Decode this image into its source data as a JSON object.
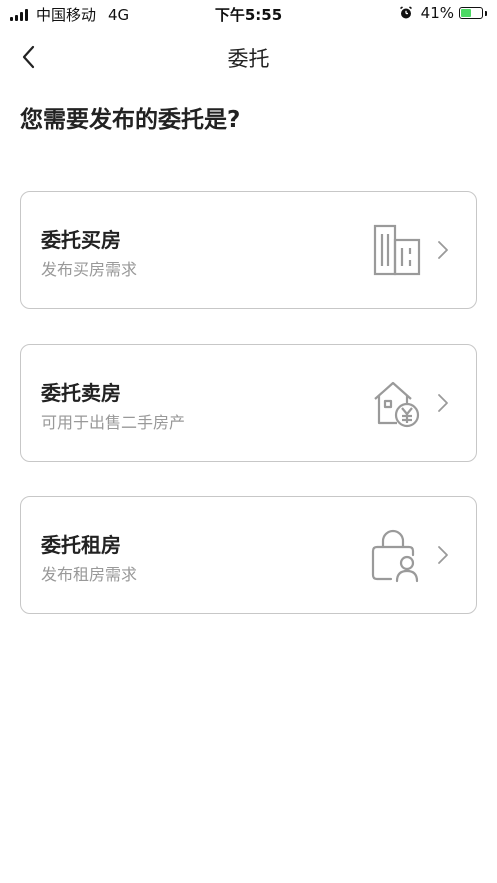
{
  "status_bar": {
    "carrier": "中国移动",
    "network": "4G",
    "time": "下午5:55",
    "battery_percent": "41%"
  },
  "nav": {
    "title": "委托"
  },
  "question": "您需要发布的委托是?",
  "options": [
    {
      "title": "委托买房",
      "subtitle": "发布买房需求",
      "icon": "building-icon"
    },
    {
      "title": "委托卖房",
      "subtitle": "可用于出售二手房产",
      "icon": "house-yuan-icon"
    },
    {
      "title": "委托租房",
      "subtitle": "发布租房需求",
      "icon": "lock-person-icon"
    }
  ],
  "colors": {
    "border": "#c7c7c7",
    "subtitle": "#999999",
    "icon": "#9a9a9a",
    "battery": "#4cd964"
  }
}
